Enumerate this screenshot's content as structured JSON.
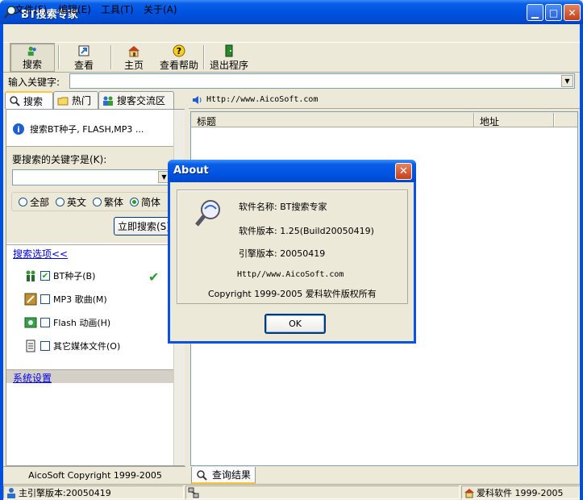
{
  "window": {
    "title": "BT搜索专家"
  },
  "menu": {
    "items": [
      "文件(F)",
      "编辑(E)",
      "工具(T)",
      "关于(A)"
    ]
  },
  "toolbar": {
    "search": "搜索",
    "view": "查看",
    "home": "主页",
    "help": "查看帮助",
    "exit": "退出程序"
  },
  "keyword_bar": {
    "label": "输入关键字:",
    "value": ""
  },
  "left_tabs": [
    "搜索",
    "热门",
    "搜客交流区"
  ],
  "left_panel": {
    "info": "搜索BT种子, FLASH,MP3 ...",
    "keyword_label": "要搜索的关键字是(K):",
    "keyword_value": "",
    "radios": [
      {
        "label": "全部",
        "selected": false
      },
      {
        "label": "英文",
        "selected": false
      },
      {
        "label": "繁体",
        "selected": false
      },
      {
        "label": "简体",
        "selected": true
      }
    ],
    "search_now": "立即搜索(S)",
    "options_link": "搜索选项<<",
    "options": [
      {
        "label": "BT种子(B)",
        "checked": true
      },
      {
        "label": "MP3 歌曲(M)",
        "checked": false
      },
      {
        "label": "Flash 动画(H)",
        "checked": false
      },
      {
        "label": "其它媒体文件(O)",
        "checked": false
      }
    ],
    "system_link": "系统设置",
    "footer": "AicoSoft Copyright 1999-2005"
  },
  "right_panel": {
    "url": "Http://www.AicoSoft.com",
    "columns": [
      "标题",
      "地址"
    ],
    "result_tab": "查询结果"
  },
  "statusbar": {
    "engine": "主引擎版本:20050419",
    "middle": "",
    "brand": "爱科软件 1999-2005"
  },
  "about": {
    "title": "About",
    "name_line": "软件名称: BT搜索专家",
    "version_line": "软件版本: 1.25(Build20050419)",
    "engine_line": "引擎版本:  20050419",
    "url": "Http//www.AicoSoft.com",
    "copyright": "Copyright 1999-2005 爱科软件版权所有",
    "ok": "OK"
  },
  "colors": {
    "xp_blue": "#0054e3",
    "face": "#ece9d8",
    "link": "#0000ee",
    "tab_highlight": "#ffc83c"
  }
}
